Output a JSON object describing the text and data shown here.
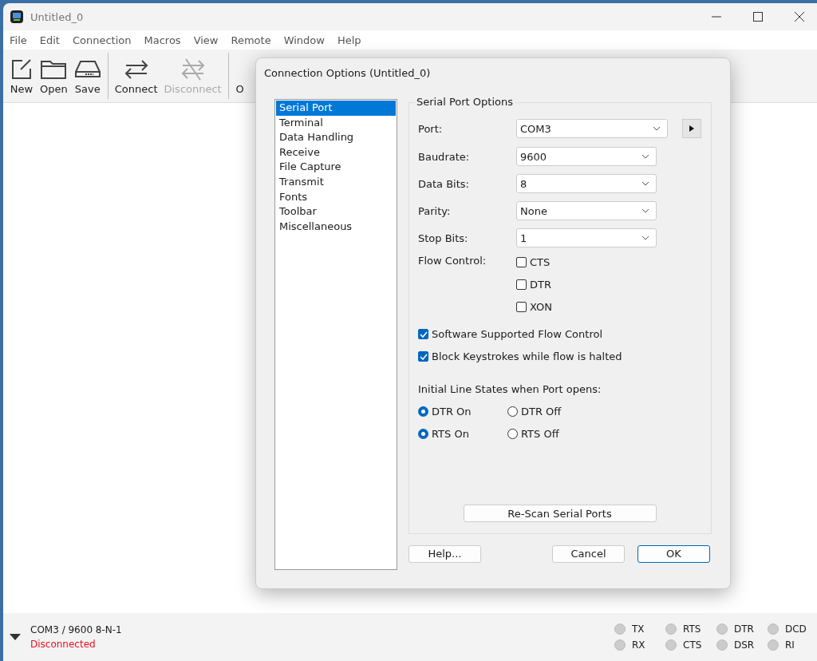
{
  "window": {
    "title": "Untitled_0"
  },
  "menu": [
    "File",
    "Edit",
    "Connection",
    "Macros",
    "View",
    "Remote",
    "Window",
    "Help"
  ],
  "toolbar": [
    {
      "label": "New",
      "kind": "new",
      "disabled": false
    },
    {
      "label": "Open",
      "kind": "open",
      "disabled": false
    },
    {
      "label": "Save",
      "kind": "save",
      "disabled": false
    },
    {
      "label": "Connect",
      "kind": "connect",
      "disabled": false
    },
    {
      "label": "Disconnect",
      "kind": "disconnect",
      "disabled": true
    },
    {
      "label": "O",
      "kind": "partial",
      "disabled": false
    }
  ],
  "dialog": {
    "title": "Connection Options (Untitled_0)",
    "categories": [
      {
        "label": "Serial Port",
        "selected": true
      },
      {
        "label": "Terminal",
        "selected": false
      },
      {
        "label": "Data Handling",
        "selected": false
      },
      {
        "label": "Receive",
        "selected": false
      },
      {
        "label": "File Capture",
        "selected": false
      },
      {
        "label": "Transmit",
        "selected": false
      },
      {
        "label": "Fonts",
        "selected": false
      },
      {
        "label": "Toolbar",
        "selected": false
      },
      {
        "label": "Miscellaneous",
        "selected": false
      }
    ],
    "group_title": "Serial Port Options",
    "fields": [
      {
        "label": "Port:",
        "value": "COM3"
      },
      {
        "label": "Baudrate:",
        "value": "9600"
      },
      {
        "label": "Data Bits:",
        "value": "8"
      },
      {
        "label": "Parity:",
        "value": "None"
      },
      {
        "label": "Stop Bits:",
        "value": "1"
      }
    ],
    "flow_control": {
      "label": "Flow Control:",
      "options": [
        {
          "label": "CTS",
          "checked": false
        },
        {
          "label": "DTR",
          "checked": false
        },
        {
          "label": "XON",
          "checked": false
        }
      ]
    },
    "checkboxes": [
      {
        "label": "Software Supported Flow Control",
        "checked": true
      },
      {
        "label": "Block Keystrokes while flow is halted",
        "checked": true
      }
    ],
    "line_states": {
      "label": "Initial Line States when Port opens:",
      "rows": [
        [
          {
            "label": "DTR On",
            "selected": true
          },
          {
            "label": "DTR Off",
            "selected": false
          }
        ],
        [
          {
            "label": "RTS On",
            "selected": true
          },
          {
            "label": "RTS Off",
            "selected": false
          }
        ]
      ]
    },
    "rescan_button": "Re-Scan Serial Ports",
    "buttons": [
      {
        "label": "Help...",
        "default": false
      },
      {
        "label": "Cancel",
        "default": false
      },
      {
        "label": "OK",
        "default": true
      }
    ]
  },
  "status_bar": {
    "port": "COM3 / 9600 8-N-1",
    "state": "Disconnected",
    "lights": [
      {
        "label": "TX",
        "on": false
      },
      {
        "label": "RX",
        "on": false
      },
      {
        "label": "RTS",
        "on": false
      },
      {
        "label": "CTS",
        "on": false
      },
      {
        "label": "DTR",
        "on": false
      },
      {
        "label": "DSR",
        "on": false
      },
      {
        "label": "DCD",
        "on": false
      },
      {
        "label": "RI",
        "on": false
      }
    ]
  }
}
